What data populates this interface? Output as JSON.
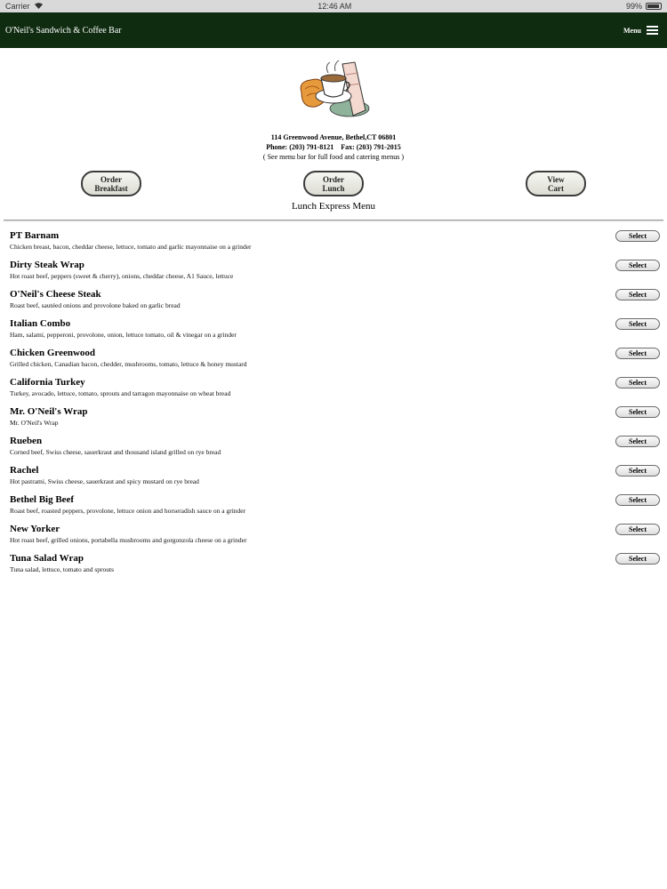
{
  "status_bar": {
    "carrier": "Carrier",
    "time": "12:46 AM",
    "battery": "99%"
  },
  "header": {
    "title": "O'Neil's Sandwich & Coffee Bar",
    "menu_label": "Menu"
  },
  "info": {
    "address": "114 Greenwood Avenue, Bethel,CT 06801",
    "phone": "Phone: (203) 791-8121",
    "fax": "Fax: (203) 791-2015",
    "note": "( See menu bar for full food and catering menus )"
  },
  "buttons": {
    "order_breakfast": [
      "Order",
      "Breakfast"
    ],
    "order_lunch": [
      "Order",
      "Lunch"
    ],
    "view_cart": [
      "View",
      "Cart"
    ]
  },
  "menu_heading": "Lunch Express Menu",
  "select_label": "Select",
  "items": [
    {
      "name": "PT Barnam",
      "desc": "Chicken breast, bacon, cheddar cheese, lettuce, tomato and garlic mayonnaise on a grinder"
    },
    {
      "name": "Dirty Steak Wrap",
      "desc": "Hot roast beef, peppers (sweet & cherry), onions, cheddar cheese, A1 Sauce, lettuce"
    },
    {
      "name": "O'Neil's Cheese Steak",
      "desc": "Roast beef, sautéed onions and provolone baked on garlic bread"
    },
    {
      "name": "Italian Combo",
      "desc": "Ham, salami, pepperoni, provolone, onion, lettuce tomato, oil & vinegar on a grinder"
    },
    {
      "name": "Chicken Greenwood",
      "desc": "Grilled chicken, Canadian bacon, chedder, mushrooms, tomato, lettuce & honey mustard"
    },
    {
      "name": "California Turkey",
      "desc": "Turkey, avocado, lettuce, tomato, sprouts and tarragon mayonnaise on wheat bread"
    },
    {
      "name": "Mr. O'Neil's Wrap",
      "desc": "Mr. O'Neil's Wrap"
    },
    {
      "name": "Rueben",
      "desc": "Corned beef, Swiss cheese, sauerkraut and thousand island grilled on rye bread"
    },
    {
      "name": "Rachel",
      "desc": "Hot pastrami, Swiss cheese, sauerkraut and spicy mustard on rye bread"
    },
    {
      "name": "Bethel Big Beef",
      "desc": "Roast beef, roasted peppers, provolone, lettuce onion and horseradish sauce on a grinder"
    },
    {
      "name": "New Yorker",
      "desc": "Hot roast beef, grilled onions, portabella mushrooms and gorgonzola cheese on a grinder"
    },
    {
      "name": "Tuna Salad Wrap",
      "desc": "Tuna salad, lettuce, tomato and sprouts"
    }
  ],
  "colors": {
    "header_bg": "#0f2b10",
    "status_bg": "#d9d9d9"
  },
  "icons": [
    "wifi-icon",
    "battery-icon",
    "hamburger-icon",
    "coffee-logo"
  ]
}
